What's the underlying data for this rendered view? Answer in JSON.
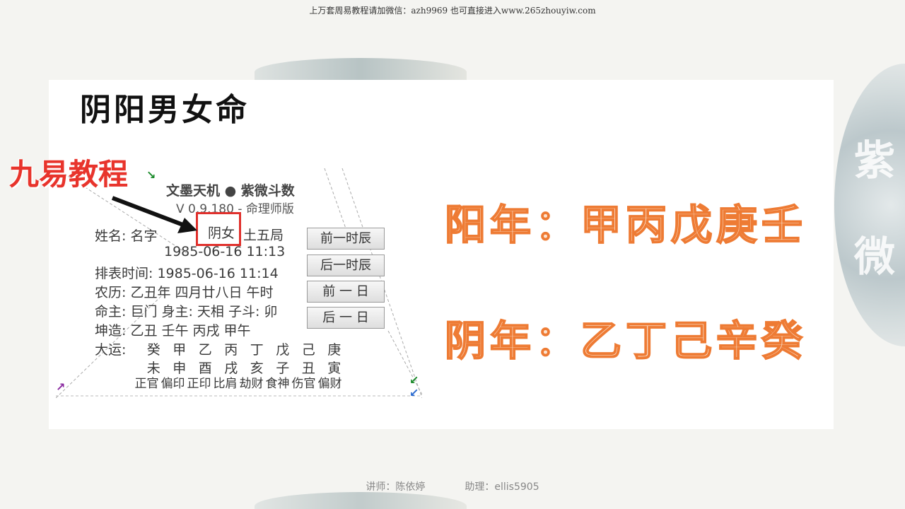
{
  "banner": {
    "text": "上万套周易教程请加微信：azh9969   也可直接进入www.265zhouyiw.com"
  },
  "background": {
    "side_chars": [
      "紫",
      "微"
    ]
  },
  "slide": {
    "title": "阴阳男女命",
    "watermark": "九易教程",
    "yang_line": "阳年：甲丙戊庚壬",
    "yin_line": "阴年：乙丁己辛癸"
  },
  "software": {
    "app_name": "文墨天机 ● 紫微斗数",
    "version": "V 0.9.180 - 命理师版",
    "name_row": "姓名: 名字",
    "gender_tag": "阴女",
    "bureau": "土五局",
    "birth_row": "1985-06-16 11:13",
    "chart_time_row": "排表时间: 1985-06-16 11:14",
    "lunar_row": "农历: 乙丑年 四月廿八日 午时",
    "master_row": "命主: 巨门 身主: 天相 子斗: 卯",
    "bazi_row": "坤造: 乙丑   壬午   丙戌   甲午",
    "luck_label": "大运:",
    "luck_stems": [
      "癸",
      "甲",
      "乙",
      "丙",
      "丁",
      "戊",
      "己",
      "庚"
    ],
    "luck_branches": [
      "未",
      "申",
      "酉",
      "戌",
      "亥",
      "子",
      "丑",
      "寅"
    ],
    "ten_gods": [
      "正官",
      "偏印",
      "正印",
      "比肩",
      "劫财",
      "食神",
      "伤官",
      "偏财"
    ],
    "buttons": {
      "prev_hour": "前一时辰",
      "next_hour": "后一时辰",
      "prev_day": "前 一 日",
      "next_day": "后 一 日"
    }
  },
  "footer": {
    "lecturer": "讲师：陈依婷",
    "assistant": "助理：ellis5905"
  },
  "colors": {
    "accent_orange": "#ee7b34",
    "watermark_red": "#e8342c",
    "highlight_red": "#e0302c"
  }
}
